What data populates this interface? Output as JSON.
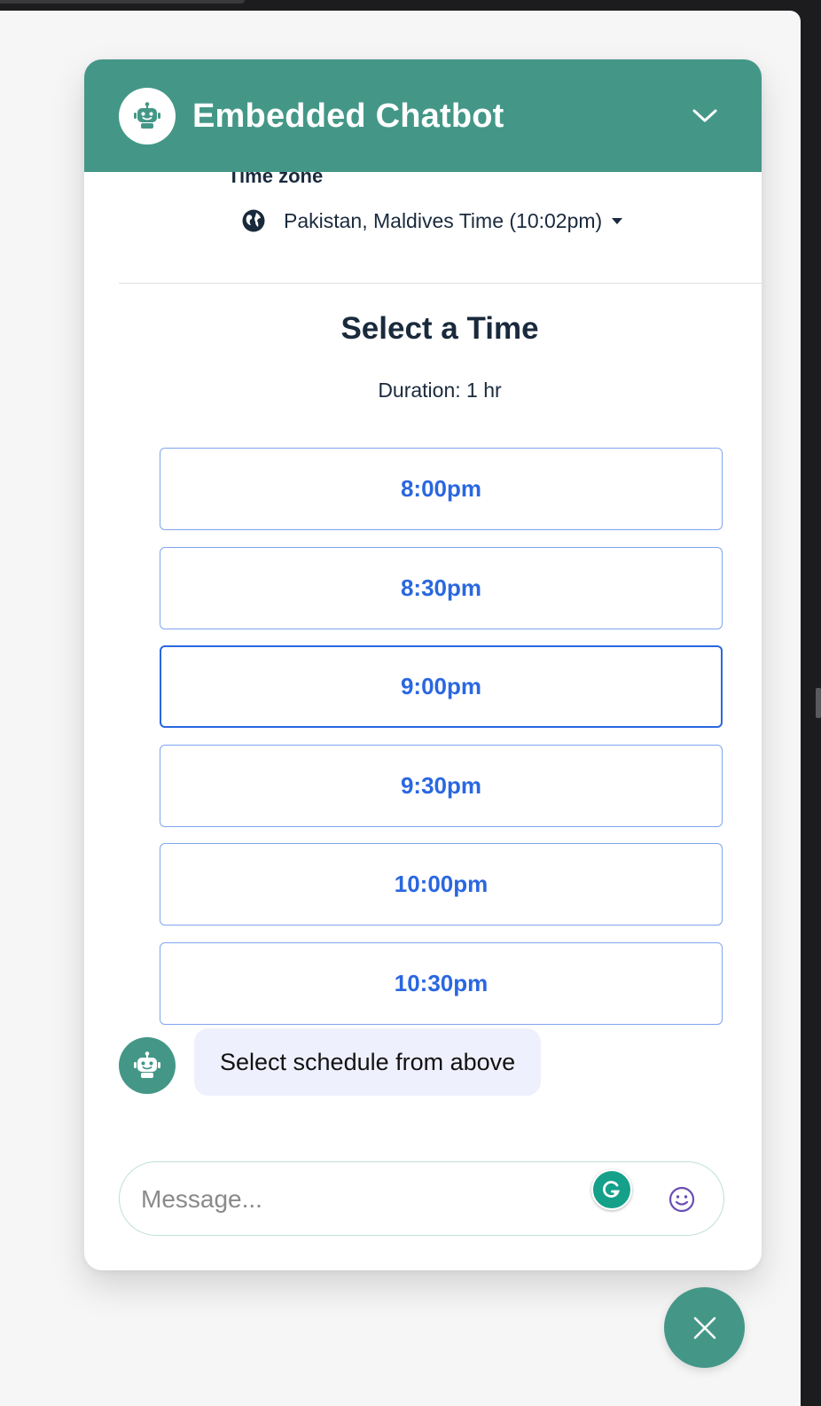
{
  "chatbot": {
    "title": "Embedded Chatbot",
    "brand_color": "#449787"
  },
  "scheduler": {
    "timezone_label": "Time zone",
    "timezone_value": "Pakistan, Maldives Time (10:02pm)",
    "heading": "Select a Time",
    "duration": "Duration: 1 hr",
    "slot_color": "#2a67e0",
    "slots": [
      {
        "label": "8:00pm",
        "selected": false
      },
      {
        "label": "8:30pm",
        "selected": false
      },
      {
        "label": "9:00pm",
        "selected": true
      },
      {
        "label": "9:30pm",
        "selected": false
      },
      {
        "label": "10:00pm",
        "selected": false
      },
      {
        "label": "10:30pm",
        "selected": false
      }
    ]
  },
  "messages": [
    {
      "from": "bot",
      "text": "Select schedule from above"
    }
  ],
  "composer": {
    "placeholder": "Message...",
    "icons": [
      "grammarly-icon",
      "emoji-icon"
    ]
  },
  "fab": {
    "icon": "close-icon"
  }
}
